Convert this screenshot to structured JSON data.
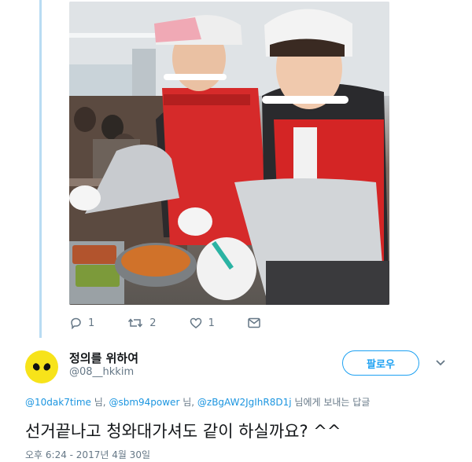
{
  "colors": {
    "accent": "#1da1f2",
    "mention": "#1b95e0",
    "muted": "#657786",
    "text": "#14171a",
    "thread_line": "#b9dcf3",
    "avatar_bg": "#f7e31a"
  },
  "parent_tweet": {
    "actions": {
      "reply_count": "1",
      "retweet_count": "2",
      "like_count": "1"
    }
  },
  "reply": {
    "author_name": "정의를 위하여",
    "author_handle": "@08__hkkim",
    "follow_label": "팔로우",
    "replying_to": {
      "mentions": [
        "@10dak7time",
        "@sbm94power",
        "@zBgAW2JgIhR8D1j"
      ],
      "separator": "님,",
      "suffix": "님에게 보내는 답글"
    },
    "text": "선거끝나고 청와대가셔도 같이 하실까요? ^^",
    "timestamp": "오후 6:24 - 2017년 4월 30일"
  },
  "icons": [
    "reply-icon",
    "retweet-icon",
    "like-icon",
    "message-icon",
    "chevron-down-icon"
  ]
}
